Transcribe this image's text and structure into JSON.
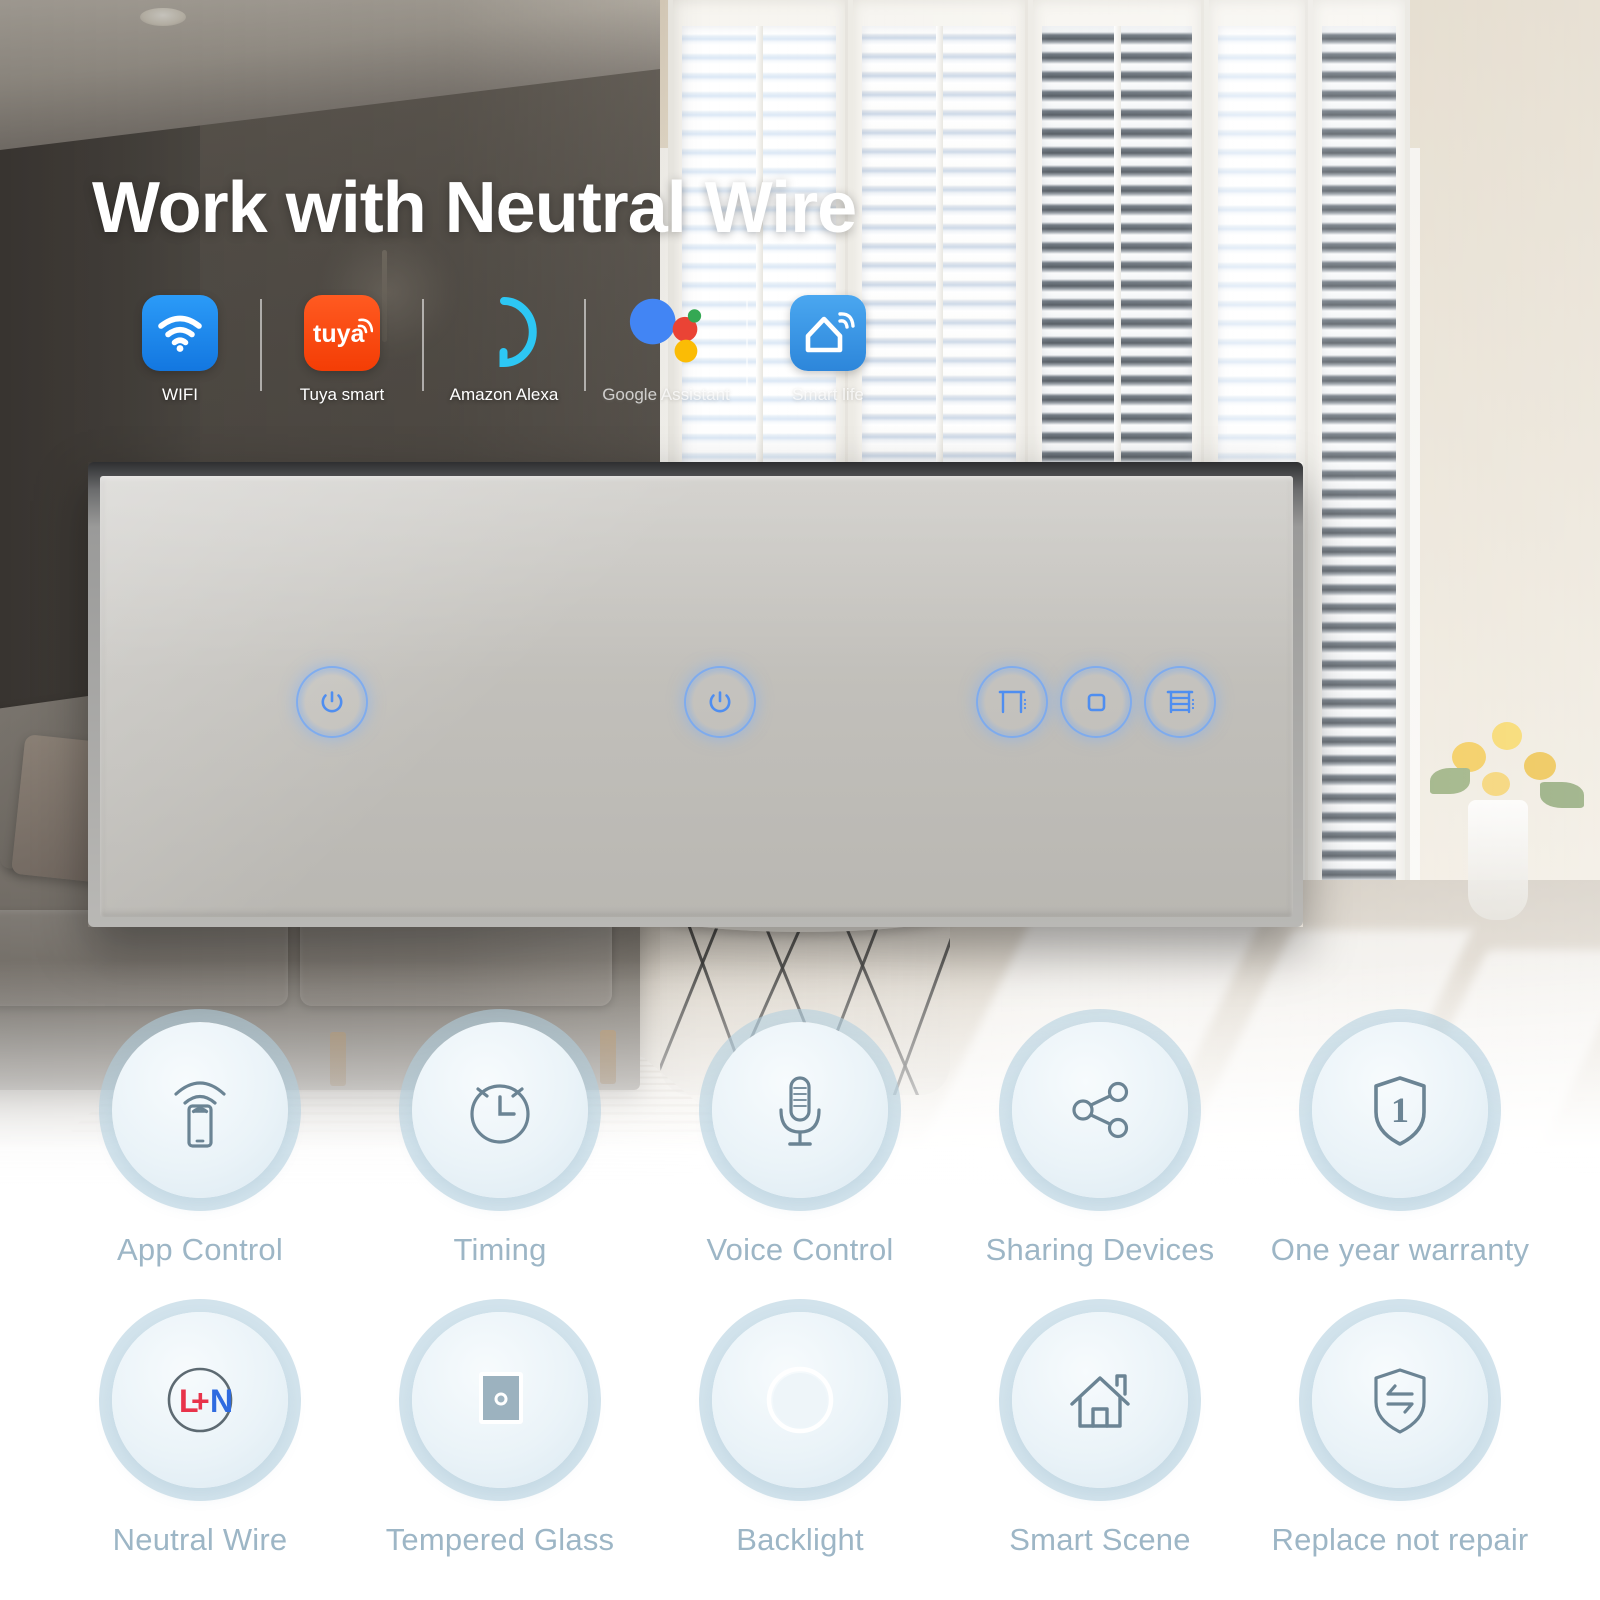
{
  "headline": "Work with Neutral Wire",
  "colors": {
    "brand_wifi": "#1E90F5",
    "brand_tuya": "#FF4713",
    "brand_alexa": "#2DC7F4",
    "brand_smartlife": "#3C9BE8",
    "google_blue": "#4285F4",
    "google_red": "#EA4335",
    "google_yellow": "#FBBC05",
    "google_green": "#34A853",
    "touch_glow": "#6EA5FA",
    "feature_label": "#9DB6C6",
    "live_wire": "#E8334A",
    "neutral_wire": "#2F6BE0"
  },
  "brands": [
    {
      "id": "wifi",
      "label": "WIFI",
      "icon": "wifi-icon",
      "washed": false
    },
    {
      "id": "tuya-smart",
      "label": "Tuya smart",
      "icon": "tuya-logo-icon",
      "washed": false
    },
    {
      "id": "amazon-alexa",
      "label": "Amazon Alexa",
      "icon": "alexa-ring-icon",
      "washed": false
    },
    {
      "id": "google-assistant",
      "label": "Google Assistant",
      "icon": "google-assistant-icon",
      "washed": true
    },
    {
      "id": "smart-life",
      "label": "Smart life",
      "icon": "smart-life-icon",
      "washed": true
    }
  ],
  "panel": {
    "buttons": [
      {
        "id": "gang-1",
        "icon": "power-icon"
      },
      {
        "id": "gang-2",
        "icon": "power-icon"
      },
      {
        "id": "curtain-open",
        "icon": "curtain-open-icon"
      },
      {
        "id": "curtain-stop",
        "icon": "curtain-stop-icon"
      },
      {
        "id": "curtain-close",
        "icon": "curtain-close-icon"
      }
    ]
  },
  "features": {
    "row1": [
      {
        "id": "app-control",
        "label": "App Control",
        "icon": "phone-signal-icon"
      },
      {
        "id": "timing",
        "label": "Timing",
        "icon": "alarm-clock-icon"
      },
      {
        "id": "voice-control",
        "label": "Voice Control",
        "icon": "microphone-icon"
      },
      {
        "id": "sharing-devices",
        "label": "Sharing Devices",
        "icon": "share-nodes-icon"
      },
      {
        "id": "warranty",
        "label": "One year warranty",
        "icon": "shield-one-icon",
        "badge": "1"
      }
    ],
    "row2": [
      {
        "id": "neutral-wire",
        "label": "Neutral Wire",
        "icon": "l-plus-n-icon",
        "text_l": "L",
        "text_plus": "+",
        "text_n": "N"
      },
      {
        "id": "tempered-glass",
        "label": "Tempered Glass",
        "icon": "glass-panel-icon"
      },
      {
        "id": "backlight",
        "label": "Backlight",
        "icon": "backlight-ring-icon"
      },
      {
        "id": "smart-scene",
        "label": "Smart Scene",
        "icon": "house-icon"
      },
      {
        "id": "replace",
        "label": "Replace not repair",
        "icon": "shield-exchange-icon"
      }
    ]
  }
}
